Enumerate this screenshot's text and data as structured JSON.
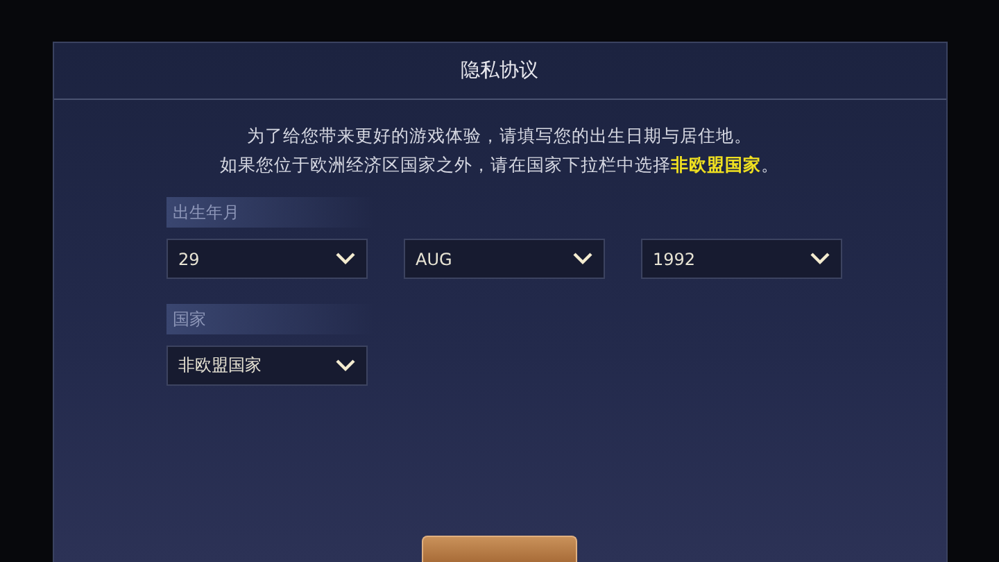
{
  "dialog": {
    "title": "隐私协议",
    "message": [
      "为了给您带来更好的游戏体验，请填写您的出生日期与居住地。",
      "如果您位于欧洲经济区国家之外，请在国家下拉栏中选择**非欧盟国家**。"
    ],
    "birth_date": {
      "label": "出生年月",
      "selects": [
        {
          "value": "29"
        },
        {
          "value": "AUG"
        },
        {
          "value": "1992"
        }
      ]
    },
    "country": {
      "label": "国家",
      "select": {
        "value": "非欧盟国家"
      }
    },
    "next_button": {
      "kind": "partial"
    }
  }
}
